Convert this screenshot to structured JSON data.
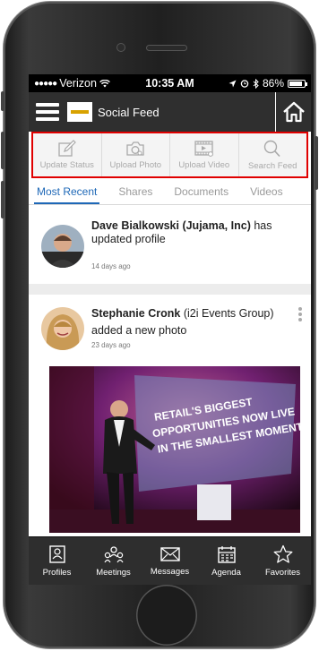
{
  "status_bar": {
    "carrier": "Verizon",
    "time": "10:35 AM",
    "battery": "86%",
    "battery_level": 0.86
  },
  "header": {
    "title": "Social Feed"
  },
  "actions": [
    {
      "label": "Update Status",
      "icon": "edit-icon"
    },
    {
      "label": "Upload Photo",
      "icon": "camera-icon"
    },
    {
      "label": "Upload Video",
      "icon": "video-icon"
    },
    {
      "label": "Search Feed",
      "icon": "search-icon"
    }
  ],
  "tabs": [
    {
      "label": "Most Recent",
      "active": true
    },
    {
      "label": "Shares",
      "active": false
    },
    {
      "label": "Documents",
      "active": false
    },
    {
      "label": "Videos",
      "active": false
    }
  ],
  "feed": [
    {
      "name": "Dave Bialkowski (Jujama, Inc)",
      "action_prefix": "has",
      "action": "updated profile",
      "time": "14 days ago"
    },
    {
      "name": "Stephanie Cronk",
      "org": "(i2i Events Group)",
      "action": "added a new photo",
      "time": "23 days ago",
      "photo_text": [
        "RETAIL'S BIGGEST",
        "OPPORTUNITIES NOW LIVE",
        "IN THE SMALLEST MOMENTS"
      ]
    }
  ],
  "bottom_nav": [
    {
      "label": "Profiles",
      "icon": "profiles-icon"
    },
    {
      "label": "Meetings",
      "icon": "meetings-icon"
    },
    {
      "label": "Messages",
      "icon": "messages-icon"
    },
    {
      "label": "Agenda",
      "icon": "agenda-icon"
    },
    {
      "label": "Favorites",
      "icon": "star-icon"
    }
  ],
  "colors": {
    "accent": "#1e68b7",
    "highlight": "#e00000",
    "header_bg": "#2f2f2f"
  }
}
